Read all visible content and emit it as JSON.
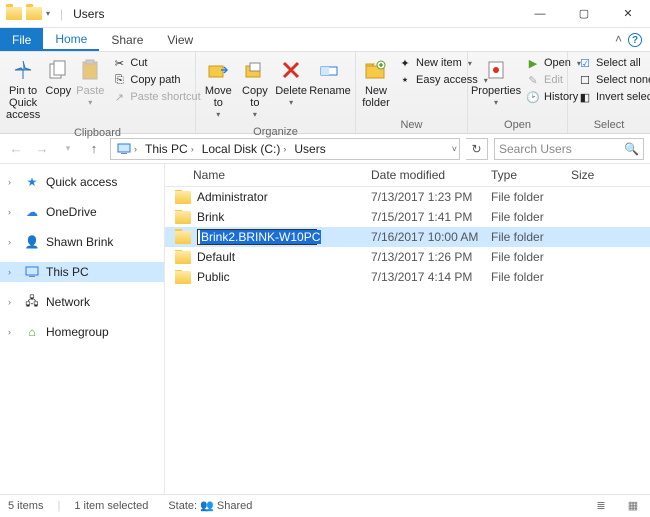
{
  "window": {
    "title": "Users",
    "min_sym": "—",
    "max_sym": "▢",
    "close_sym": "✕"
  },
  "tabs": {
    "file": "File",
    "home": "Home",
    "share": "Share",
    "view": "View"
  },
  "ribbon": {
    "clipboard": {
      "label": "Clipboard",
      "pin": "Pin to Quick access",
      "copy": "Copy",
      "paste": "Paste",
      "cut": "Cut",
      "copy_path": "Copy path",
      "paste_shortcut": "Paste shortcut"
    },
    "organize": {
      "label": "Organize",
      "move_to": "Move to",
      "copy_to": "Copy to",
      "delete": "Delete",
      "rename": "Rename"
    },
    "new": {
      "label": "New",
      "new_folder": "New folder",
      "new_item": "New item",
      "easy_access": "Easy access"
    },
    "open": {
      "label": "Open",
      "properties": "Properties",
      "open": "Open",
      "edit": "Edit",
      "history": "History"
    },
    "select": {
      "label": "Select",
      "select_all": "Select all",
      "select_none": "Select none",
      "invert": "Invert selection"
    }
  },
  "nav": {
    "this_pc": "This PC",
    "local_disk": "Local Disk (C:)",
    "users": "Users",
    "search_placeholder": "Search Users"
  },
  "navpane": {
    "quick_access": "Quick access",
    "onedrive": "OneDrive",
    "shawn": "Shawn Brink",
    "this_pc": "This PC",
    "network": "Network",
    "homegroup": "Homegroup"
  },
  "columns": {
    "name": "Name",
    "date": "Date modified",
    "type": "Type",
    "size": "Size"
  },
  "rows": [
    {
      "name": "Administrator",
      "date": "7/13/2017 1:23 PM",
      "type": "File folder",
      "selected": false
    },
    {
      "name": "Brink",
      "date": "7/15/2017 1:41 PM",
      "type": "File folder",
      "selected": false
    },
    {
      "name": "Brink2.BRINK-W10PC",
      "date": "7/16/2017 10:00 AM",
      "type": "File folder",
      "selected": true,
      "renaming": true
    },
    {
      "name": "Default",
      "date": "7/13/2017 1:26 PM",
      "type": "File folder",
      "selected": false
    },
    {
      "name": "Public",
      "date": "7/13/2017 4:14 PM",
      "type": "File folder",
      "selected": false
    }
  ],
  "status": {
    "items": "5 items",
    "selected": "1 item selected",
    "state_label": "State:",
    "state_value": "Shared"
  }
}
